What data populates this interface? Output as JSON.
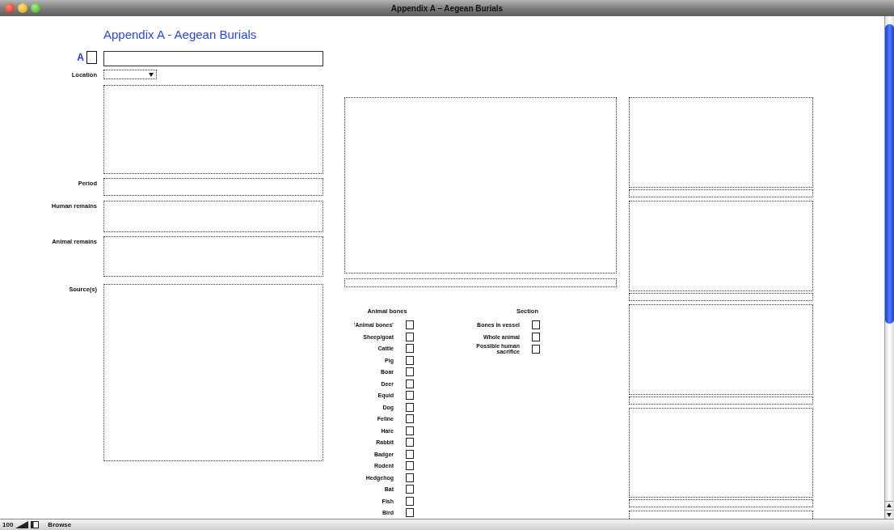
{
  "window": {
    "title": "Appendix A – Aegean Burials"
  },
  "layout_title": "Appendix A - Aegean Burials",
  "record": {
    "label": "A"
  },
  "left_fields": [
    {
      "label": "Location",
      "kind": "dropdown"
    },
    {
      "kind": "box"
    },
    {
      "label": "Period",
      "kind": "box"
    },
    {
      "label": "Human remains",
      "kind": "box"
    },
    {
      "label": "Animal remains",
      "kind": "box"
    },
    {
      "label": "Source(s)",
      "kind": "box"
    }
  ],
  "animal_bones": {
    "heading": "Animal bones",
    "items": [
      {
        "label": "'Animal bones'",
        "checked": false
      },
      {
        "label": "Sheep/goat",
        "checked": false
      },
      {
        "label": "Cattle",
        "checked": false
      },
      {
        "label": "Pig",
        "checked": false
      },
      {
        "label": "Boar",
        "checked": false
      },
      {
        "label": "Deer",
        "checked": false
      },
      {
        "label": "Equid",
        "checked": false
      },
      {
        "label": "Dog",
        "checked": false
      },
      {
        "label": "Feline",
        "checked": false
      },
      {
        "label": "Hare",
        "checked": false
      },
      {
        "label": "Rabbit",
        "checked": false
      },
      {
        "label": "Badger",
        "checked": false
      },
      {
        "label": "Rodent",
        "checked": false
      },
      {
        "label": "Hedgehog",
        "checked": false
      },
      {
        "label": "Bat",
        "checked": false
      },
      {
        "label": "Fish",
        "checked": false
      },
      {
        "label": "Bird",
        "checked": false
      }
    ]
  },
  "section": {
    "heading": "Section",
    "items": [
      {
        "label": "Bones in vessel",
        "checked": false
      },
      {
        "label": "Whole animal",
        "checked": false
      },
      {
        "label": "Possible human sacrifice",
        "checked": false
      }
    ]
  },
  "status_bar": {
    "zoom": "100",
    "mode": "Browse"
  }
}
